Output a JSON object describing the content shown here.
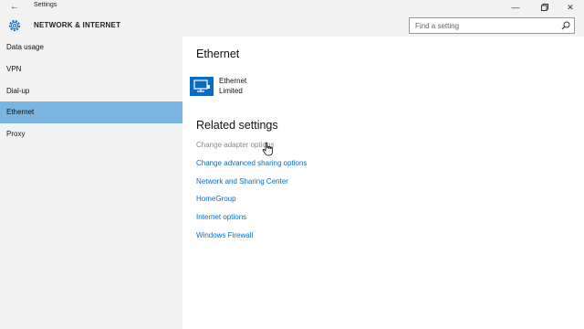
{
  "window": {
    "title": "Settings",
    "back_icon": "back-arrow-icon",
    "controls": [
      "minimize-icon",
      "restore-icon",
      "close-icon"
    ]
  },
  "header": {
    "section_title": "NETWORK & INTERNET",
    "icon": "gear-icon",
    "search_placeholder": "Find a setting"
  },
  "sidebar": {
    "items": [
      {
        "label": "Data usage",
        "selected": false
      },
      {
        "label": "VPN",
        "selected": false
      },
      {
        "label": "Dial-up",
        "selected": false
      },
      {
        "label": "Ethernet",
        "selected": true
      },
      {
        "label": "Proxy",
        "selected": false
      }
    ]
  },
  "main": {
    "page_title": "Ethernet",
    "connection": {
      "name": "Ethernet",
      "status": "Limited",
      "icon": "ethernet-adapter-icon"
    },
    "related_title": "Related settings",
    "links": [
      "Change adapter options",
      "Change advanced sharing options",
      "Network and Sharing Center",
      "HomeGroup",
      "Internet options",
      "Windows Firewall"
    ]
  },
  "colors": {
    "accent": "#0a6bc1",
    "selected_nav": "#7ab4e0",
    "chrome_bg": "#f2f2f2"
  }
}
